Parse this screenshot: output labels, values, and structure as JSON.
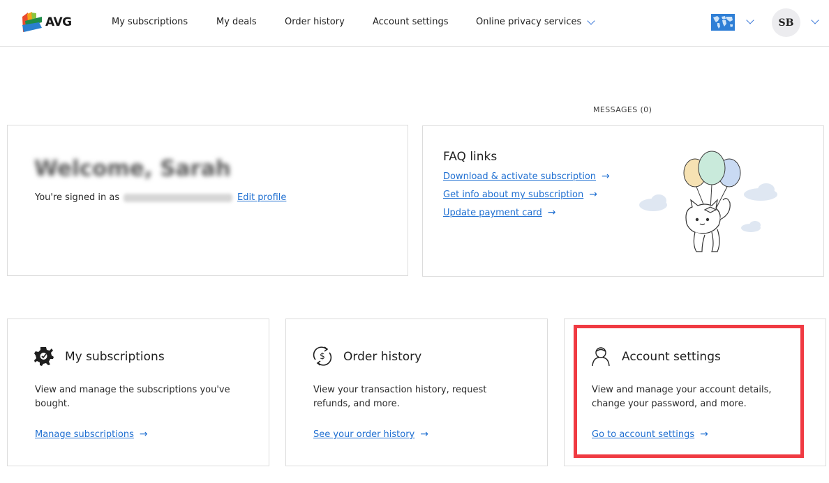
{
  "header": {
    "logo_text": "AVG",
    "nav": [
      {
        "label": "My subscriptions"
      },
      {
        "label": "My deals"
      },
      {
        "label": "Order history"
      },
      {
        "label": "Account settings"
      },
      {
        "label": "Online privacy services"
      }
    ],
    "avatar_initials": "SB",
    "icons": [
      "avg-logo-icon",
      "world-map-icon",
      "chevron-down-icon"
    ]
  },
  "messages": "MESSAGES (0)",
  "welcome": {
    "title": "Welcome, Sarah",
    "signed_in_text": "You're signed in as",
    "edit_profile": "Edit profile"
  },
  "faq": {
    "title": "FAQ links",
    "links": [
      {
        "label": "Download & activate subscription"
      },
      {
        "label": "Get info about my subscription"
      },
      {
        "label": "Update payment card"
      }
    ]
  },
  "cards": [
    {
      "title": "My subscriptions",
      "description": "View and manage the subscriptions you've bought.",
      "link": "Manage subscriptions",
      "icon": "gear-check-icon"
    },
    {
      "title": "Order history",
      "description": "View your transaction history, request refunds, and more.",
      "link": "See your order history",
      "icon": "dollar-refresh-icon"
    },
    {
      "title": "Account settings",
      "description": "View and manage your account details, change your password, and more.",
      "link": "Go to account settings",
      "icon": "user-icon"
    }
  ],
  "colors": {
    "link": "#1f6fd1",
    "highlight": "#f03a42",
    "border": "#dcdcdc"
  }
}
